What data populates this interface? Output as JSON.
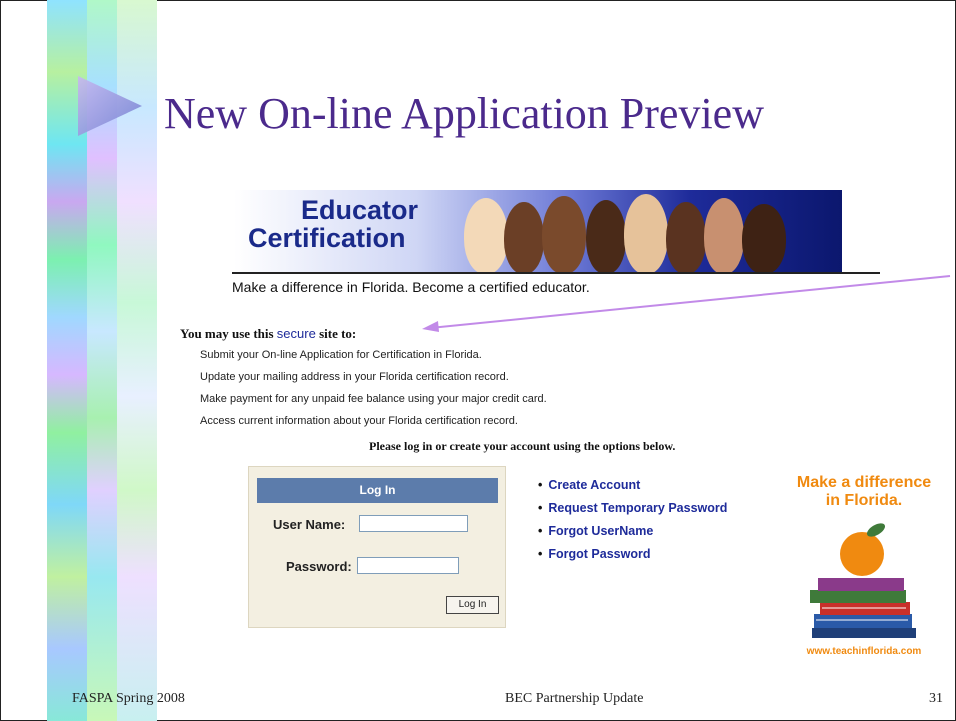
{
  "slide": {
    "title": "New On-line Application Preview",
    "footer_left": "FASPA Spring 2008",
    "footer_center": "BEC Partnership Update",
    "page_number": "31"
  },
  "banner": {
    "title_line1": "Educator",
    "title_line2": "Certification",
    "tagline": "Make a difference in Florida. Become a certified educator."
  },
  "intro": {
    "prefix": "You may use this",
    "link": "secure",
    "suffix": "site to:"
  },
  "bullets": [
    "Submit your On-line Application for Certification in Florida.",
    "Update your mailing address in your Florida certification record.",
    "Make payment for any unpaid fee balance using your major credit card.",
    "Access current information about your Florida certification record."
  ],
  "please_text": "Please log in or create your account using the options below.",
  "login": {
    "header": "Log In",
    "username_label": "User Name:",
    "username_value": "",
    "password_label": "Password:",
    "password_value": "",
    "button_label": "Log In"
  },
  "links": [
    "Create Account",
    "Request Temporary Password",
    "Forgot UserName",
    "Forgot Password"
  ],
  "promo": {
    "line1": "Make a difference",
    "line2": "in Florida.",
    "url": "www.teachinflorida.com"
  },
  "colors": {
    "title": "#4b2a8c",
    "link": "#1e2b9a",
    "login_header": "#5c7cab",
    "promo": "#f08a10"
  }
}
